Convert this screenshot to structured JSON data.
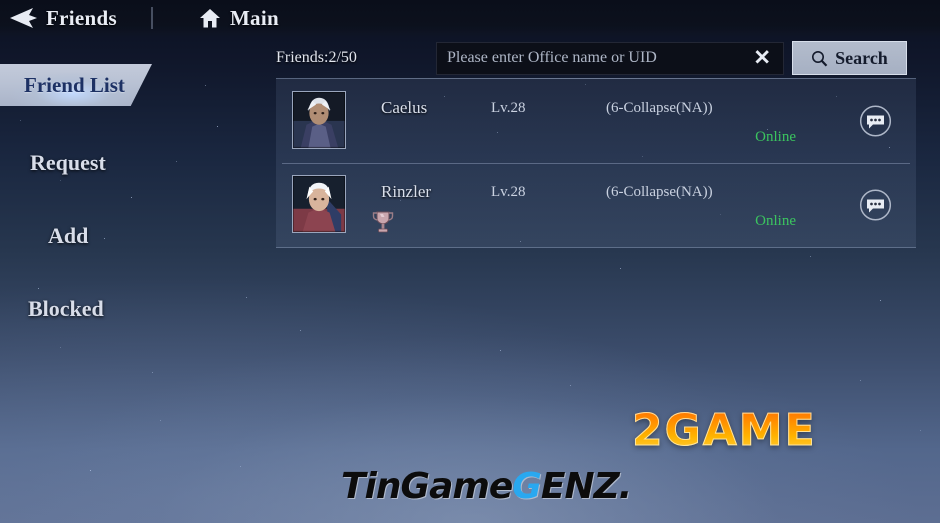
{
  "topbar": {
    "back_icon": "back-arrow-icon",
    "title": "Friends",
    "home_icon": "home-icon",
    "main_label": "Main"
  },
  "sidebar": {
    "items": [
      {
        "id": "friend-list",
        "label": "Friend List",
        "active": true
      },
      {
        "id": "request",
        "label": "Request",
        "active": false
      },
      {
        "id": "add",
        "label": "Add",
        "active": false
      },
      {
        "id": "blocked",
        "label": "Blocked",
        "active": false
      }
    ]
  },
  "search": {
    "friend_count_label": "Friends:2/50",
    "placeholder": "Please enter Office name or UID",
    "value": "",
    "clear_icon": "close-x-icon",
    "search_icon": "magnifier-icon",
    "search_label": "Search"
  },
  "friends": [
    {
      "name": "Caelus",
      "level": "Lv.28",
      "server": "(6-Collapse(NA))",
      "status": "Online",
      "has_trophy": false,
      "chat_icon": "chat-bubble-icon",
      "avatar_icon": "avatar-portrait"
    },
    {
      "name": "Rinzler",
      "level": "Lv.28",
      "server": "(6-Collapse(NA))",
      "status": "Online",
      "has_trophy": true,
      "trophy_icon": "trophy-icon",
      "chat_icon": "chat-bubble-icon",
      "avatar_icon": "avatar-portrait"
    }
  ],
  "watermarks": {
    "brand_2game": "2GAME",
    "brand_tingame_a": "TinGame",
    "brand_tingame_b": "G",
    "brand_tingame_c": "ENZ."
  },
  "colors": {
    "online": "#3bc45f",
    "accent_tab": "#1d3164",
    "brand_orange": "#ff8c00",
    "brand_blue": "#29a8f0"
  }
}
